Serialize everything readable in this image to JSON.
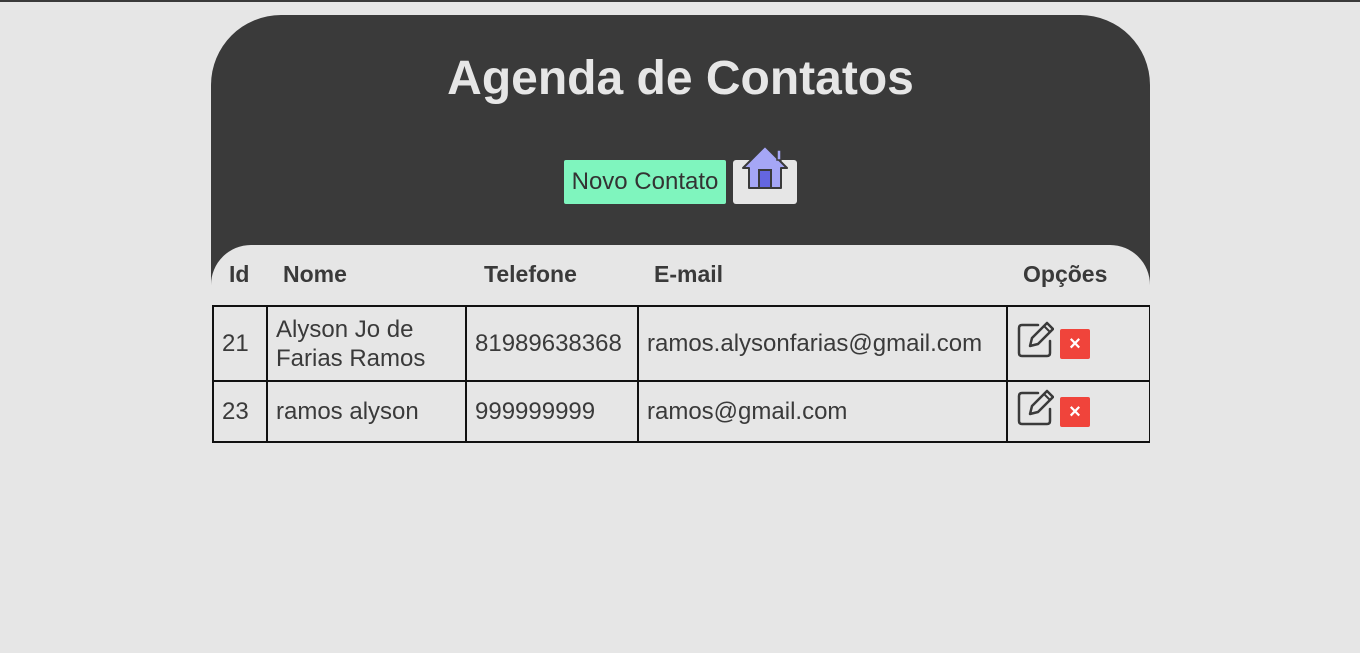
{
  "header": {
    "title": "Agenda de Contatos",
    "new_contact_label": "Novo Contato",
    "home_icon": "home-icon"
  },
  "table": {
    "headers": {
      "id": "Id",
      "name": "Nome",
      "phone": "Telefone",
      "email": "E-mail",
      "options": "Opções"
    },
    "rows": [
      {
        "id": "21",
        "name": "Alyson Jo de Farias Ramos",
        "phone": "81989638368",
        "email": "ramos.alysonfarias@gmail.com",
        "edit_icon": "edit-icon",
        "delete_label": "×"
      },
      {
        "id": "23",
        "name": "ramos alyson",
        "phone": "999999999",
        "email": "ramos@gmail.com",
        "edit_icon": "edit-icon",
        "delete_label": "×"
      }
    ]
  },
  "colors": {
    "card_bg": "#3a3a3a",
    "page_bg": "#e6e6e6",
    "new_button": "#7ff5be",
    "delete_button": "#f0443b",
    "home_icon_fill": "#a5a6f6"
  }
}
